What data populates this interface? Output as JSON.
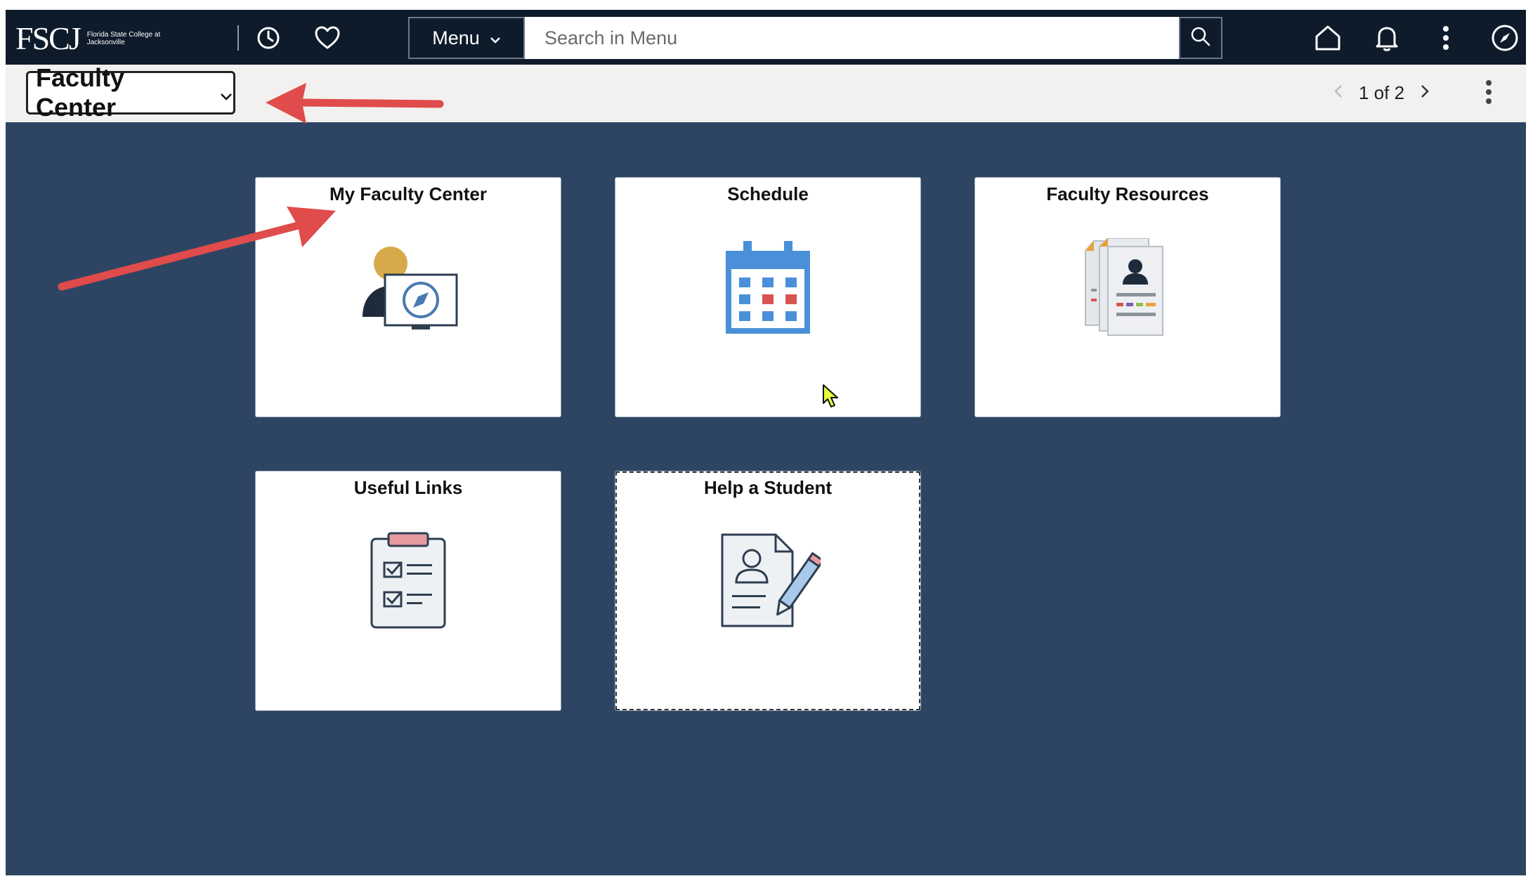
{
  "header": {
    "logo_text": "FSCJ",
    "logo_subtext": "Florida State College at Jacksonville",
    "menu_label": "Menu",
    "search_placeholder": "Search in Menu",
    "icons": [
      "history-icon",
      "favorites-icon",
      "search-icon",
      "home-icon",
      "notifications-icon",
      "actions-kebab-icon",
      "navbar-compass-icon"
    ]
  },
  "subheader": {
    "page_title": "Faculty Center",
    "pager_text": "1 of 2"
  },
  "tiles": [
    {
      "label": "My Faculty Center",
      "icon": "person-monitor-compass-icon"
    },
    {
      "label": "Schedule",
      "icon": "calendar-icon"
    },
    {
      "label": "Faculty Resources",
      "icon": "profile-documents-icon"
    },
    {
      "label": "Useful Links",
      "icon": "clipboard-checklist-icon"
    },
    {
      "label": "Help a Student",
      "icon": "document-pencil-icon"
    }
  ],
  "annotations": {
    "arrow_color": "#e04b4b"
  },
  "colors": {
    "topbar": "#0d1b2a",
    "canvas": "#2d4563",
    "calendar_blue": "#4a90d9",
    "calendar_red": "#d9534f"
  }
}
